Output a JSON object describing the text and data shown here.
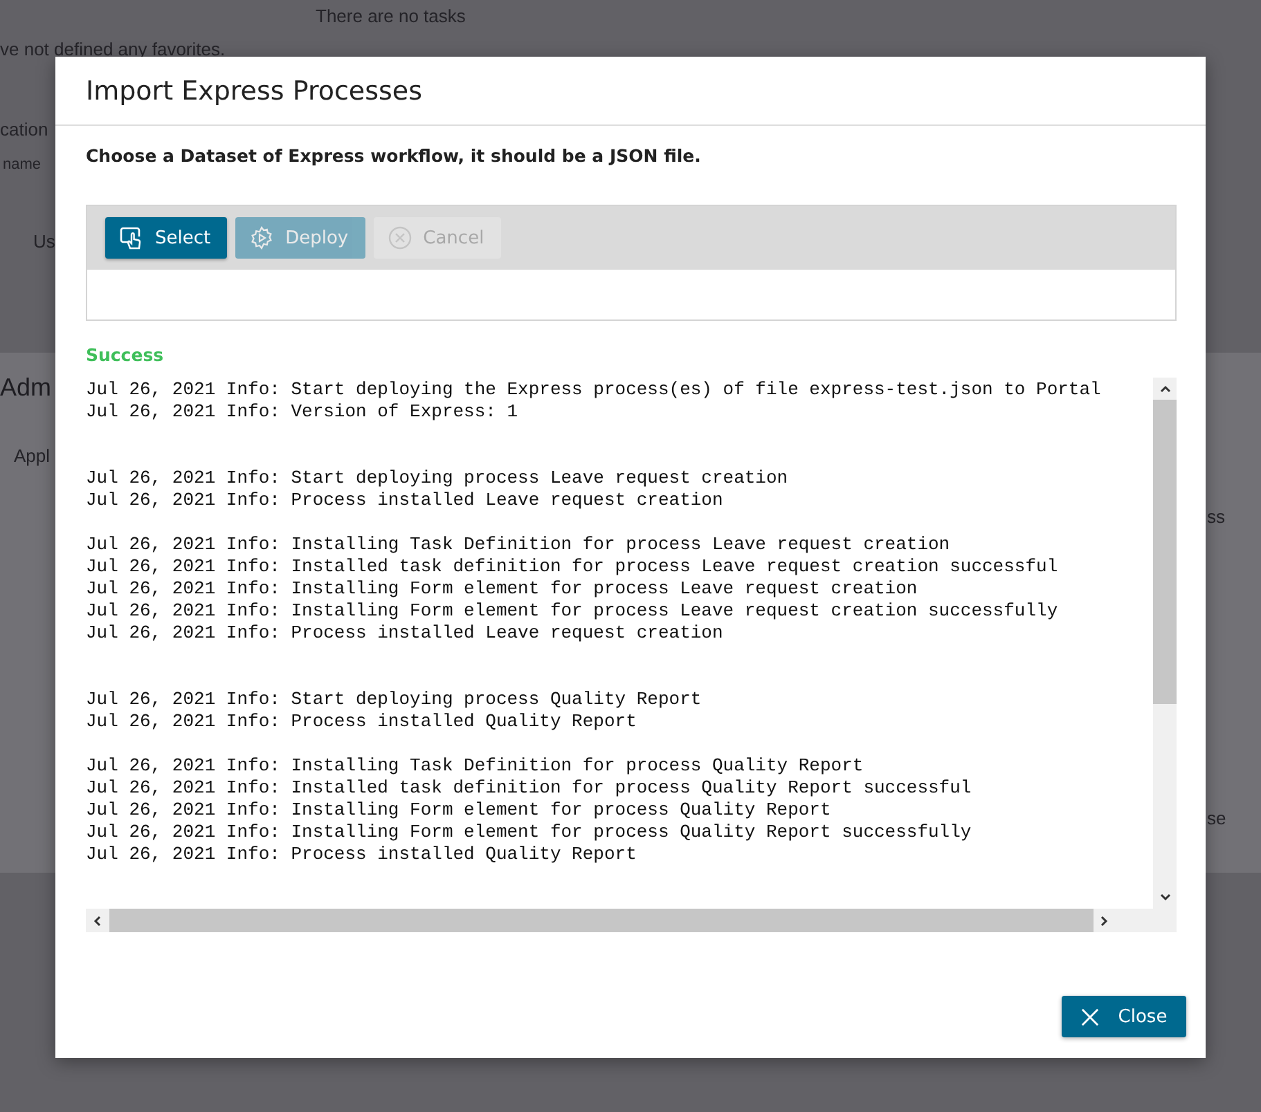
{
  "background": {
    "texts": [
      "There are no tasks",
      "ve not defined any favorites.",
      "cation",
      "name",
      "Us",
      "Adm",
      "Appl",
      "ss",
      "se"
    ]
  },
  "dialog": {
    "title": "Import Express Processes",
    "instruction": "Choose a Dataset of Express workflow, it should be a JSON file.",
    "toolbar": [
      {
        "label": "Select",
        "kind": "select",
        "disabled": false
      },
      {
        "label": "Deploy",
        "kind": "deploy",
        "disabled": true
      },
      {
        "label": "Cancel",
        "kind": "cancel",
        "disabled": true
      }
    ],
    "status": "Success",
    "log": [
      {
        "kind": "line",
        "text": "Jul 26, 2021 Info: Start deploying the Express process(es) of file express-test.json to Portal"
      },
      {
        "kind": "line",
        "text": "Jul 26, 2021 Info: Version of Express: 1"
      },
      {
        "kind": "blank"
      },
      {
        "kind": "blank"
      },
      {
        "kind": "line",
        "text": "Jul 26, 2021 Info: Start deploying process Leave request creation"
      },
      {
        "kind": "line",
        "text": "Jul 26, 2021 Info: Process installed Leave request creation"
      },
      {
        "kind": "blank"
      },
      {
        "kind": "line",
        "text": "Jul 26, 2021 Info: Installing Task Definition for process Leave request creation"
      },
      {
        "kind": "line",
        "text": "Jul 26, 2021 Info: Installed task definition for process Leave request creation successful"
      },
      {
        "kind": "line",
        "text": "Jul 26, 2021 Info: Installing Form element for process Leave request creation"
      },
      {
        "kind": "line",
        "text": "Jul 26, 2021 Info: Installing Form element for process Leave request creation successfully"
      },
      {
        "kind": "line",
        "text": "Jul 26, 2021 Info: Process installed Leave request creation"
      },
      {
        "kind": "blank"
      },
      {
        "kind": "blank"
      },
      {
        "kind": "line",
        "text": "Jul 26, 2021 Info: Start deploying process Quality Report"
      },
      {
        "kind": "line",
        "text": "Jul 26, 2021 Info: Process installed Quality Report"
      },
      {
        "kind": "blank"
      },
      {
        "kind": "line",
        "text": "Jul 26, 2021 Info: Installing Task Definition for process Quality Report"
      },
      {
        "kind": "line",
        "text": "Jul 26, 2021 Info: Installed task definition for process Quality Report successful"
      },
      {
        "kind": "line",
        "text": "Jul 26, 2021 Info: Installing Form element for process Quality Report"
      },
      {
        "kind": "line",
        "text": "Jul 26, 2021 Info: Installing Form element for process Quality Report successfully"
      },
      {
        "kind": "line",
        "text": "Jul 26, 2021 Info: Process installed Quality Report"
      }
    ],
    "close_button": "Close"
  }
}
